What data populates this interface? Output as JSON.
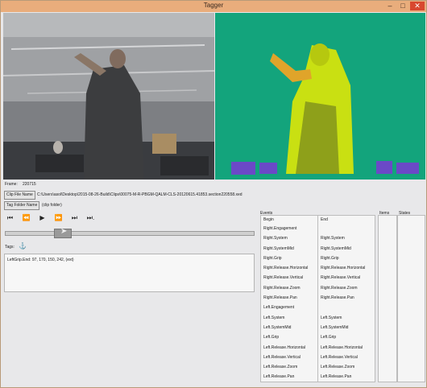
{
  "window": {
    "title": "Tagger"
  },
  "frame": {
    "label": "Frame:",
    "value": "220715"
  },
  "clip_file": {
    "button": "Clip File Name",
    "path": "C:\\Users\\asol\\Desktop\\2015-08-26-Build\\Clips\\00075-M-R-PBGM-QALM-CLS-20120615.41853.section220558.xed"
  },
  "tag_folder": {
    "button": "Tag Folder Name",
    "value": "(clip folder)"
  },
  "playback": [
    "⏮",
    "⏪",
    "▶",
    "⏩",
    "⏭",
    "⏭."
  ],
  "tags": {
    "label": "Tags:",
    "entry": "LeftGrip.End: 97, 170, 150, 242, (ext)"
  },
  "events": {
    "label": "Events",
    "begin_header": "Begin",
    "end_header": "End",
    "begin": [
      "Right.Engagement",
      "Right.System",
      "Right.SystemMid",
      "Right.Grip",
      "Right.Release.Horizontal",
      "Right.Release.Vertical",
      "Right.Release.Zoom",
      "Right.Release.Pan",
      "Left.Engagement",
      "Left.System",
      "Left.SystemMid",
      "Left.Grip",
      "Left.Release.Horizontal",
      "Left.Release.Vertical",
      "Left.Release.Zoom",
      "Left.Release.Pan"
    ],
    "end": [
      "",
      "Right.System",
      "Right.SystemMid",
      "Right.Grip",
      "Right.Release.Horizontal",
      "Right.Release.Vertical",
      "Right.Release.Zoom",
      "Right.Release.Pan",
      "",
      "Left.System",
      "Left.SystemMid",
      "Left.Grip",
      "Left.Release.Horizontal",
      "Left.Release.Vertical",
      "Left.Release.Zoom",
      "Left.Release.Pan"
    ]
  },
  "items": {
    "label": "Items"
  },
  "states": {
    "label": "States"
  },
  "colors": {
    "titlebar": "#e9ad7c",
    "close": "#d8482f",
    "depth_bg": "#13a47c"
  }
}
